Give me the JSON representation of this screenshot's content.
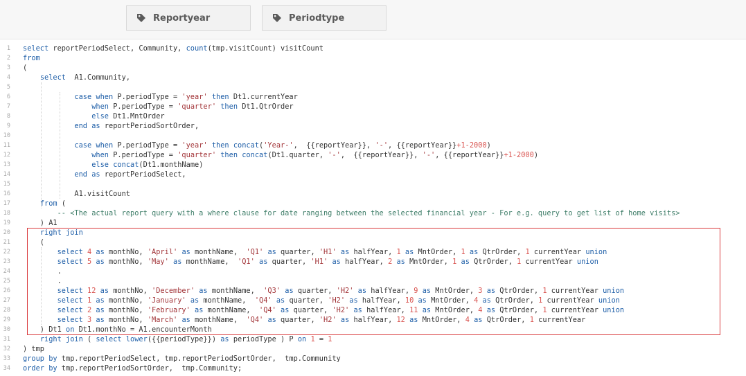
{
  "filters": [
    {
      "label": "Reportyear",
      "icon": "tag-icon"
    },
    {
      "label": "Periodtype",
      "icon": "tag-icon"
    }
  ],
  "colors": {
    "keyword": "#1f5fa8",
    "string": "#a3363a",
    "number": "#d9534f",
    "comment": "#3e7d68",
    "plain": "#333333",
    "line_number": "#a8a8a8",
    "highlight_border": "#d9393c"
  },
  "code_lines": [
    {
      "n": "1",
      "t": [
        [
          "k",
          "select"
        ],
        [
          "p",
          " reportPeriodSelect, Community, "
        ],
        [
          "k",
          "count"
        ],
        [
          "p",
          "(tmp.visitCount) visitCount"
        ]
      ]
    },
    {
      "n": "2",
      "t": [
        [
          "k",
          "from"
        ]
      ]
    },
    {
      "n": "3",
      "t": [
        [
          "p",
          "("
        ]
      ]
    },
    {
      "n": "4",
      "t": [
        [
          "p",
          "    "
        ],
        [
          "k",
          "select"
        ],
        [
          "p",
          "  A1.Community,"
        ]
      ]
    },
    {
      "n": "5",
      "t": []
    },
    {
      "n": "6",
      "t": [
        [
          "p",
          "            "
        ],
        [
          "k",
          "case when"
        ],
        [
          "p",
          " P.periodType = "
        ],
        [
          "s",
          "'year'"
        ],
        [
          "p",
          " "
        ],
        [
          "k",
          "then"
        ],
        [
          "p",
          " Dt1.currentYear"
        ]
      ]
    },
    {
      "n": "7",
      "t": [
        [
          "p",
          "                "
        ],
        [
          "k",
          "when"
        ],
        [
          "p",
          " P.periodType = "
        ],
        [
          "s",
          "'quarter'"
        ],
        [
          "p",
          " "
        ],
        [
          "k",
          "then"
        ],
        [
          "p",
          " Dt1.QtrOrder"
        ]
      ]
    },
    {
      "n": "8",
      "t": [
        [
          "p",
          "                "
        ],
        [
          "k",
          "else"
        ],
        [
          "p",
          " Dt1.MntOrder"
        ]
      ]
    },
    {
      "n": "9",
      "t": [
        [
          "p",
          "            "
        ],
        [
          "k",
          "end"
        ],
        [
          "p",
          " "
        ],
        [
          "k",
          "as"
        ],
        [
          "p",
          " reportPeriodSortOrder,"
        ]
      ]
    },
    {
      "n": "10",
      "t": []
    },
    {
      "n": "11",
      "t": [
        [
          "p",
          "            "
        ],
        [
          "k",
          "case when"
        ],
        [
          "p",
          " P.periodType = "
        ],
        [
          "s",
          "'year'"
        ],
        [
          "p",
          " "
        ],
        [
          "k",
          "then"
        ],
        [
          "p",
          " "
        ],
        [
          "k",
          "concat"
        ],
        [
          "p",
          "("
        ],
        [
          "s",
          "'Year-'"
        ],
        [
          "p",
          ",  {{reportYear}}, "
        ],
        [
          "s",
          "'-'"
        ],
        [
          "p",
          ", {{reportYear}}"
        ],
        [
          "n",
          "+1-2000"
        ],
        [
          "p",
          ")"
        ]
      ]
    },
    {
      "n": "12",
      "t": [
        [
          "p",
          "                "
        ],
        [
          "k",
          "when"
        ],
        [
          "p",
          " P.periodType = "
        ],
        [
          "s",
          "'quarter'"
        ],
        [
          "p",
          " "
        ],
        [
          "k",
          "then"
        ],
        [
          "p",
          " "
        ],
        [
          "k",
          "concat"
        ],
        [
          "p",
          "(Dt1.quarter, "
        ],
        [
          "s",
          "'-'"
        ],
        [
          "p",
          ",  {{reportYear}}, "
        ],
        [
          "s",
          "'-'"
        ],
        [
          "p",
          ", {{reportYear}}"
        ],
        [
          "n",
          "+1-2000"
        ],
        [
          "p",
          ")"
        ]
      ]
    },
    {
      "n": "13",
      "t": [
        [
          "p",
          "                "
        ],
        [
          "k",
          "else"
        ],
        [
          "p",
          " "
        ],
        [
          "k",
          "concat"
        ],
        [
          "p",
          "(Dt1.monthName)"
        ]
      ]
    },
    {
      "n": "14",
      "t": [
        [
          "p",
          "            "
        ],
        [
          "k",
          "end"
        ],
        [
          "p",
          " "
        ],
        [
          "k",
          "as"
        ],
        [
          "p",
          " reportPeriodSelect,"
        ]
      ]
    },
    {
      "n": "15",
      "t": []
    },
    {
      "n": "16",
      "t": [
        [
          "p",
          "            A1.visitCount"
        ]
      ]
    },
    {
      "n": "17",
      "t": [
        [
          "p",
          "    "
        ],
        [
          "k",
          "from"
        ],
        [
          "p",
          " ("
        ]
      ]
    },
    {
      "n": "18",
      "t": [
        [
          "p",
          "        "
        ],
        [
          "c",
          "-- <The actual report query with a where clause for date ranging between the selected financial year - For e.g. query to get list of home visits>"
        ]
      ]
    },
    {
      "n": "19",
      "t": [
        [
          "p",
          "    ) A1"
        ]
      ]
    },
    {
      "n": "20",
      "t": [
        [
          "p",
          "    "
        ],
        [
          "k",
          "right join"
        ]
      ]
    },
    {
      "n": "21",
      "t": [
        [
          "p",
          "    ("
        ]
      ]
    },
    {
      "n": "22",
      "t": [
        [
          "p",
          "        "
        ],
        [
          "k",
          "select"
        ],
        [
          "p",
          " "
        ],
        [
          "n",
          "4"
        ],
        [
          "p",
          " "
        ],
        [
          "k",
          "as"
        ],
        [
          "p",
          " monthNo, "
        ],
        [
          "s",
          "'April'"
        ],
        [
          "p",
          " "
        ],
        [
          "k",
          "as"
        ],
        [
          "p",
          " monthName,  "
        ],
        [
          "s",
          "'Q1'"
        ],
        [
          "p",
          " "
        ],
        [
          "k",
          "as"
        ],
        [
          "p",
          " quarter, "
        ],
        [
          "s",
          "'H1'"
        ],
        [
          "p",
          " "
        ],
        [
          "k",
          "as"
        ],
        [
          "p",
          " halfYear, "
        ],
        [
          "n",
          "1"
        ],
        [
          "p",
          " "
        ],
        [
          "k",
          "as"
        ],
        [
          "p",
          " MntOrder, "
        ],
        [
          "n",
          "1"
        ],
        [
          "p",
          " "
        ],
        [
          "k",
          "as"
        ],
        [
          "p",
          " QtrOrder, "
        ],
        [
          "n",
          "1"
        ],
        [
          "p",
          " currentYear "
        ],
        [
          "k",
          "union"
        ]
      ]
    },
    {
      "n": "23",
      "t": [
        [
          "p",
          "        "
        ],
        [
          "k",
          "select"
        ],
        [
          "p",
          " "
        ],
        [
          "n",
          "5"
        ],
        [
          "p",
          " "
        ],
        [
          "k",
          "as"
        ],
        [
          "p",
          " monthNo, "
        ],
        [
          "s",
          "'May'"
        ],
        [
          "p",
          " "
        ],
        [
          "k",
          "as"
        ],
        [
          "p",
          " monthName,  "
        ],
        [
          "s",
          "'Q1'"
        ],
        [
          "p",
          " "
        ],
        [
          "k",
          "as"
        ],
        [
          "p",
          " quarter, "
        ],
        [
          "s",
          "'H1'"
        ],
        [
          "p",
          " "
        ],
        [
          "k",
          "as"
        ],
        [
          "p",
          " halfYear, "
        ],
        [
          "n",
          "2"
        ],
        [
          "p",
          " "
        ],
        [
          "k",
          "as"
        ],
        [
          "p",
          " MntOrder, "
        ],
        [
          "n",
          "1"
        ],
        [
          "p",
          " "
        ],
        [
          "k",
          "as"
        ],
        [
          "p",
          " QtrOrder, "
        ],
        [
          "n",
          "1"
        ],
        [
          "p",
          " currentYear "
        ],
        [
          "k",
          "union"
        ]
      ]
    },
    {
      "n": "24",
      "t": [
        [
          "p",
          "        ."
        ]
      ]
    },
    {
      "n": "25",
      "t": [
        [
          "p",
          "        ."
        ]
      ]
    },
    {
      "n": "26",
      "t": [
        [
          "p",
          "        "
        ],
        [
          "k",
          "select"
        ],
        [
          "p",
          " "
        ],
        [
          "n",
          "12"
        ],
        [
          "p",
          " "
        ],
        [
          "k",
          "as"
        ],
        [
          "p",
          " monthNo, "
        ],
        [
          "s",
          "'December'"
        ],
        [
          "p",
          " "
        ],
        [
          "k",
          "as"
        ],
        [
          "p",
          " monthName,  "
        ],
        [
          "s",
          "'Q3'"
        ],
        [
          "p",
          " "
        ],
        [
          "k",
          "as"
        ],
        [
          "p",
          " quarter, "
        ],
        [
          "s",
          "'H2'"
        ],
        [
          "p",
          " "
        ],
        [
          "k",
          "as"
        ],
        [
          "p",
          " halfYear, "
        ],
        [
          "n",
          "9"
        ],
        [
          "p",
          " "
        ],
        [
          "k",
          "as"
        ],
        [
          "p",
          " MntOrder, "
        ],
        [
          "n",
          "3"
        ],
        [
          "p",
          " "
        ],
        [
          "k",
          "as"
        ],
        [
          "p",
          " QtrOrder, "
        ],
        [
          "n",
          "1"
        ],
        [
          "p",
          " currentYear "
        ],
        [
          "k",
          "union"
        ]
      ]
    },
    {
      "n": "27",
      "t": [
        [
          "p",
          "        "
        ],
        [
          "k",
          "select"
        ],
        [
          "p",
          " "
        ],
        [
          "n",
          "1"
        ],
        [
          "p",
          " "
        ],
        [
          "k",
          "as"
        ],
        [
          "p",
          " monthNo, "
        ],
        [
          "s",
          "'January'"
        ],
        [
          "p",
          " "
        ],
        [
          "k",
          "as"
        ],
        [
          "p",
          " monthName,  "
        ],
        [
          "s",
          "'Q4'"
        ],
        [
          "p",
          " "
        ],
        [
          "k",
          "as"
        ],
        [
          "p",
          " quarter, "
        ],
        [
          "s",
          "'H2'"
        ],
        [
          "p",
          " "
        ],
        [
          "k",
          "as"
        ],
        [
          "p",
          " halfYear, "
        ],
        [
          "n",
          "10"
        ],
        [
          "p",
          " "
        ],
        [
          "k",
          "as"
        ],
        [
          "p",
          " MntOrder, "
        ],
        [
          "n",
          "4"
        ],
        [
          "p",
          " "
        ],
        [
          "k",
          "as"
        ],
        [
          "p",
          " QtrOrder, "
        ],
        [
          "n",
          "1"
        ],
        [
          "p",
          " currentYear "
        ],
        [
          "k",
          "union"
        ]
      ]
    },
    {
      "n": "28",
      "t": [
        [
          "p",
          "        "
        ],
        [
          "k",
          "select"
        ],
        [
          "p",
          " "
        ],
        [
          "n",
          "2"
        ],
        [
          "p",
          " "
        ],
        [
          "k",
          "as"
        ],
        [
          "p",
          " monthNo, "
        ],
        [
          "s",
          "'February'"
        ],
        [
          "p",
          " "
        ],
        [
          "k",
          "as"
        ],
        [
          "p",
          " monthName,  "
        ],
        [
          "s",
          "'Q4'"
        ],
        [
          "p",
          " "
        ],
        [
          "k",
          "as"
        ],
        [
          "p",
          " quarter, "
        ],
        [
          "s",
          "'H2'"
        ],
        [
          "p",
          " "
        ],
        [
          "k",
          "as"
        ],
        [
          "p",
          " halfYear, "
        ],
        [
          "n",
          "11"
        ],
        [
          "p",
          " "
        ],
        [
          "k",
          "as"
        ],
        [
          "p",
          " MntOrder, "
        ],
        [
          "n",
          "4"
        ],
        [
          "p",
          " "
        ],
        [
          "k",
          "as"
        ],
        [
          "p",
          " QtrOrder, "
        ],
        [
          "n",
          "1"
        ],
        [
          "p",
          " currentYear "
        ],
        [
          "k",
          "union"
        ]
      ]
    },
    {
      "n": "29",
      "t": [
        [
          "p",
          "        "
        ],
        [
          "k",
          "select"
        ],
        [
          "p",
          " "
        ],
        [
          "n",
          "3"
        ],
        [
          "p",
          " "
        ],
        [
          "k",
          "as"
        ],
        [
          "p",
          " monthNo, "
        ],
        [
          "s",
          "'March'"
        ],
        [
          "p",
          " "
        ],
        [
          "k",
          "as"
        ],
        [
          "p",
          " monthName,  "
        ],
        [
          "s",
          "'Q4'"
        ],
        [
          "p",
          " "
        ],
        [
          "k",
          "as"
        ],
        [
          "p",
          " quarter, "
        ],
        [
          "s",
          "'H2'"
        ],
        [
          "p",
          " "
        ],
        [
          "k",
          "as"
        ],
        [
          "p",
          " halfYear, "
        ],
        [
          "n",
          "12"
        ],
        [
          "p",
          " "
        ],
        [
          "k",
          "as"
        ],
        [
          "p",
          " MntOrder, "
        ],
        [
          "n",
          "4"
        ],
        [
          "p",
          " "
        ],
        [
          "k",
          "as"
        ],
        [
          "p",
          " QtrOrder, "
        ],
        [
          "n",
          "1"
        ],
        [
          "p",
          " currentYear"
        ]
      ]
    },
    {
      "n": "30",
      "t": [
        [
          "p",
          "    ) Dt1 "
        ],
        [
          "k",
          "on"
        ],
        [
          "p",
          " Dt1.monthNo = A1.encounterMonth"
        ]
      ]
    },
    {
      "n": "31",
      "t": [
        [
          "p",
          "    "
        ],
        [
          "k",
          "right join"
        ],
        [
          "p",
          " ( "
        ],
        [
          "k",
          "select"
        ],
        [
          "p",
          " "
        ],
        [
          "k",
          "lower"
        ],
        [
          "p",
          "({{periodType}}) "
        ],
        [
          "k",
          "as"
        ],
        [
          "p",
          " periodType ) P "
        ],
        [
          "k",
          "on"
        ],
        [
          "p",
          " "
        ],
        [
          "n",
          "1"
        ],
        [
          "p",
          " = "
        ],
        [
          "n",
          "1"
        ]
      ]
    },
    {
      "n": "32",
      "t": [
        [
          "p",
          ") tmp"
        ]
      ]
    },
    {
      "n": "33",
      "t": [
        [
          "k",
          "group by"
        ],
        [
          "p",
          " tmp.reportPeriodSelect, tmp.reportPeriodSortOrder,  tmp.Community"
        ]
      ]
    },
    {
      "n": "34",
      "t": [
        [
          "k",
          "order by"
        ],
        [
          "p",
          " tmp.reportPeriodSortOrder,  tmp.Community;"
        ]
      ]
    }
  ]
}
